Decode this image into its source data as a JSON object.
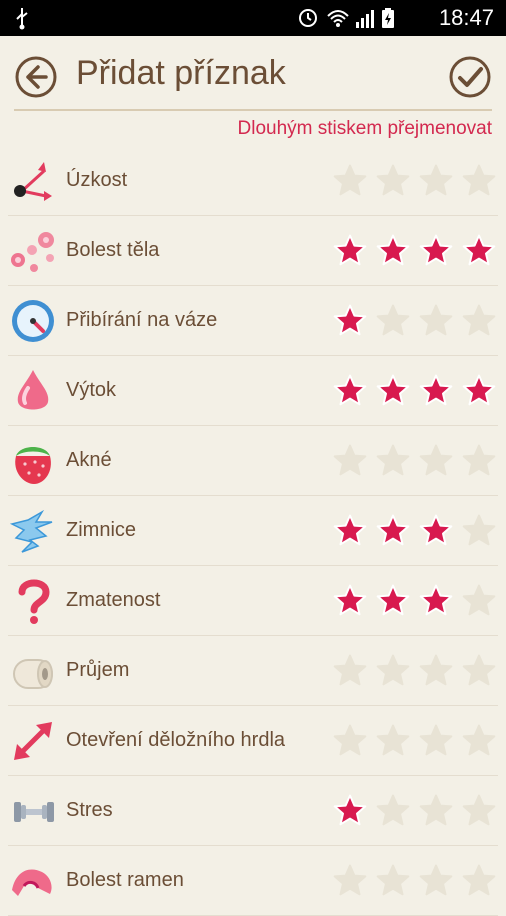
{
  "status_bar": {
    "time": "18:47"
  },
  "header": {
    "title": "Přidat příznak"
  },
  "hint": "Dlouhým stiskem přejmenovat",
  "colors": {
    "accent": "#d3294f",
    "text": "#6b4e36",
    "star_on": "#d8194f",
    "star_off": "#e8e3d5"
  },
  "symptoms": [
    {
      "label": "Úzkost",
      "icon": "clock-icon",
      "rating": 0
    },
    {
      "label": "Bolest těla",
      "icon": "dots-icon",
      "rating": 4
    },
    {
      "label": "Přibírání na váze",
      "icon": "scale-icon",
      "rating": 1
    },
    {
      "label": "Výtok",
      "icon": "drop-icon",
      "rating": 4
    },
    {
      "label": "Akné",
      "icon": "strawberry-icon",
      "rating": 0
    },
    {
      "label": "Zimnice",
      "icon": "lightning-icon",
      "rating": 3
    },
    {
      "label": "Zmatenost",
      "icon": "question-icon",
      "rating": 3
    },
    {
      "label": "Průjem",
      "icon": "toilet-paper-icon",
      "rating": 0
    },
    {
      "label": "Otevření děložního hrdla",
      "icon": "expand-arrows-icon",
      "rating": 0
    },
    {
      "label": "Stres",
      "icon": "dumbbell-icon",
      "rating": 1
    },
    {
      "label": "Bolest ramen",
      "icon": "shoulder-icon",
      "rating": 0
    }
  ]
}
